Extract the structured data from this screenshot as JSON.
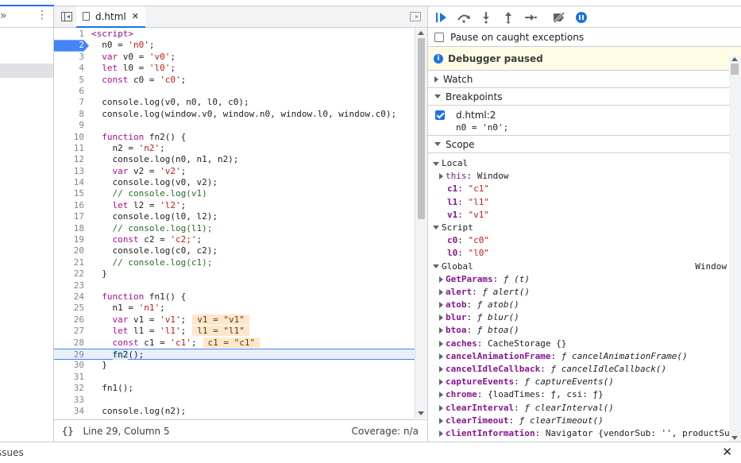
{
  "editor": {
    "tab_label": "d.html",
    "status_position": "Line 29, Column 5",
    "status_coverage": "Coverage: n/a",
    "pretty_print_label": "{}",
    "lines": [
      {
        "n": "1",
        "html": "<span class=\"tag\">&lt;script&gt;</span>"
      },
      {
        "n": "2",
        "html": "  n0 = <span class=\"str\">'n0'</span>;",
        "bp": true
      },
      {
        "n": "3",
        "html": "  <span class=\"kw\">var</span> v0 = <span class=\"str\">'v0'</span>;"
      },
      {
        "n": "4",
        "html": "  <span class=\"kw\">let</span> l0 = <span class=\"str\">'l0'</span>;"
      },
      {
        "n": "5",
        "html": "  <span class=\"kw\">const</span> c0 = <span class=\"str\">'c0'</span>;"
      },
      {
        "n": "6",
        "html": ""
      },
      {
        "n": "7",
        "html": "  console.log(v0, n0, l0, c0);"
      },
      {
        "n": "8",
        "html": "  console.log(window.v0, window.n0, window.l0, window.c0);"
      },
      {
        "n": "9",
        "html": ""
      },
      {
        "n": "10",
        "html": "  <span class=\"kw\">function</span> fn2() {"
      },
      {
        "n": "11",
        "html": "    n2 = <span class=\"str\">'n2'</span>;"
      },
      {
        "n": "12",
        "html": "    console.log(n0, n1, n2);"
      },
      {
        "n": "13",
        "html": "    <span class=\"kw\">var</span> v2 = <span class=\"str\">'v2'</span>;"
      },
      {
        "n": "14",
        "html": "    console.log(v0, v2);"
      },
      {
        "n": "15",
        "html": "    <span class=\"cmt\">// console.log(v1)</span>"
      },
      {
        "n": "16",
        "html": "    <span class=\"kw\">let</span> l2 = <span class=\"str\">'l2'</span>;"
      },
      {
        "n": "17",
        "html": "    console.log(l0, l2);"
      },
      {
        "n": "18",
        "html": "    <span class=\"cmt\">// console.log(l1);</span>"
      },
      {
        "n": "19",
        "html": "    <span class=\"kw\">const</span> c2 = <span class=\"str\">'c2;'</span>;"
      },
      {
        "n": "20",
        "html": "    console.log(c0, c2);"
      },
      {
        "n": "21",
        "html": "    <span class=\"cmt\">// console.log(c1);</span>"
      },
      {
        "n": "22",
        "html": "  }"
      },
      {
        "n": "23",
        "html": ""
      },
      {
        "n": "24",
        "html": "  <span class=\"kw\">function</span> fn1() {"
      },
      {
        "n": "25",
        "html": "    n1 = <span class=\"str\">'n1'</span>;"
      },
      {
        "n": "26",
        "html": "    <span class=\"kw\">var</span> v1 = <span class=\"str\">'v1'</span>;<span class=\"inl\">v1 = \"v1\"</span>"
      },
      {
        "n": "27",
        "html": "    <span class=\"kw\">let</span> l1 = <span class=\"str\">'l1'</span>;<span class=\"inl\">l1 = \"l1\"</span>"
      },
      {
        "n": "28",
        "html": "    <span class=\"kw\">const</span> c1 = <span class=\"str\">'c1'</span>;<span class=\"inl\">c1 = \"c1\"</span>"
      },
      {
        "n": "29",
        "html": "    <span class=\"hl\">fn2</span>();",
        "exec": true
      },
      {
        "n": "30",
        "html": "  }"
      },
      {
        "n": "31",
        "html": ""
      },
      {
        "n": "32",
        "html": "  fn1();"
      },
      {
        "n": "33",
        "html": ""
      },
      {
        "n": "34",
        "html": "  console.log(n2);"
      }
    ]
  },
  "debugger": {
    "pause_on_caught": "Pause on caught exceptions",
    "paused_label": "Debugger paused",
    "watch_label": "Watch",
    "breakpoints_label": "Breakpoints",
    "breakpoint_file": "d.html:2",
    "breakpoint_source": "n0 = 'n0';",
    "scope_label": "Scope",
    "scope_rows": [
      {
        "indent": 0,
        "tri": "d",
        "group": "Local"
      },
      {
        "indent": 1,
        "tri": "r",
        "key": "this",
        "val": "Window",
        "vt": "obj",
        "bold": false
      },
      {
        "indent": 1,
        "key": "c1",
        "val": "\"c1\"",
        "vt": "str",
        "bold": true
      },
      {
        "indent": 1,
        "key": "l1",
        "val": "\"l1\"",
        "vt": "str",
        "bold": true
      },
      {
        "indent": 1,
        "key": "v1",
        "val": "\"v1\"",
        "vt": "str",
        "bold": true
      },
      {
        "indent": 0,
        "tri": "d",
        "group": "Script"
      },
      {
        "indent": 1,
        "key": "c0",
        "val": "\"c0\"",
        "vt": "str",
        "bold": true
      },
      {
        "indent": 1,
        "key": "l0",
        "val": "\"l0\"",
        "vt": "str",
        "bold": true
      },
      {
        "indent": 0,
        "tri": "d",
        "group": "Global",
        "right": "Window"
      },
      {
        "indent": 1,
        "tri": "r",
        "key": "GetParams",
        "val": "ƒ (t)",
        "vt": "fn",
        "bold": true
      },
      {
        "indent": 1,
        "tri": "r",
        "key": "alert",
        "val": "ƒ alert()",
        "vt": "fn",
        "bold": true
      },
      {
        "indent": 1,
        "tri": "r",
        "key": "atob",
        "val": "ƒ atob()",
        "vt": "fn",
        "bold": true
      },
      {
        "indent": 1,
        "tri": "r",
        "key": "blur",
        "val": "ƒ blur()",
        "vt": "fn",
        "bold": true
      },
      {
        "indent": 1,
        "tri": "r",
        "key": "btoa",
        "val": "ƒ btoa()",
        "vt": "fn",
        "bold": true
      },
      {
        "indent": 1,
        "tri": "r",
        "key": "caches",
        "val": "CacheStorage {}",
        "vt": "obj",
        "bold": true
      },
      {
        "indent": 1,
        "tri": "r",
        "key": "cancelAnimationFrame",
        "val": "ƒ cancelAnimationFrame()",
        "vt": "fn",
        "bold": true
      },
      {
        "indent": 1,
        "tri": "r",
        "key": "cancelIdleCallback",
        "val": "ƒ cancelIdleCallback()",
        "vt": "fn",
        "bold": true
      },
      {
        "indent": 1,
        "tri": "r",
        "key": "captureEvents",
        "val": "ƒ captureEvents()",
        "vt": "fn",
        "bold": true
      },
      {
        "indent": 1,
        "tri": "r",
        "key": "chrome",
        "val": "{loadTimes: ƒ, csi: ƒ}",
        "vt": "obj",
        "bold": true
      },
      {
        "indent": 1,
        "tri": "r",
        "key": "clearInterval",
        "val": "ƒ clearInterval()",
        "vt": "fn",
        "bold": true
      },
      {
        "indent": 1,
        "tri": "r",
        "key": "clearTimeout",
        "val": "ƒ clearTimeout()",
        "vt": "fn",
        "bold": true
      },
      {
        "indent": 1,
        "tri": "r",
        "key": "clientInformation",
        "val": "Navigator {vendorSub: '', productSub",
        "vt": "obj",
        "bold": true
      }
    ]
  },
  "drawer": {
    "label": "ssues"
  },
  "colors": {
    "accent": "#1a73e8",
    "paused_bg": "#fffbe5",
    "inline_value_bg": "#ffe6cc"
  }
}
